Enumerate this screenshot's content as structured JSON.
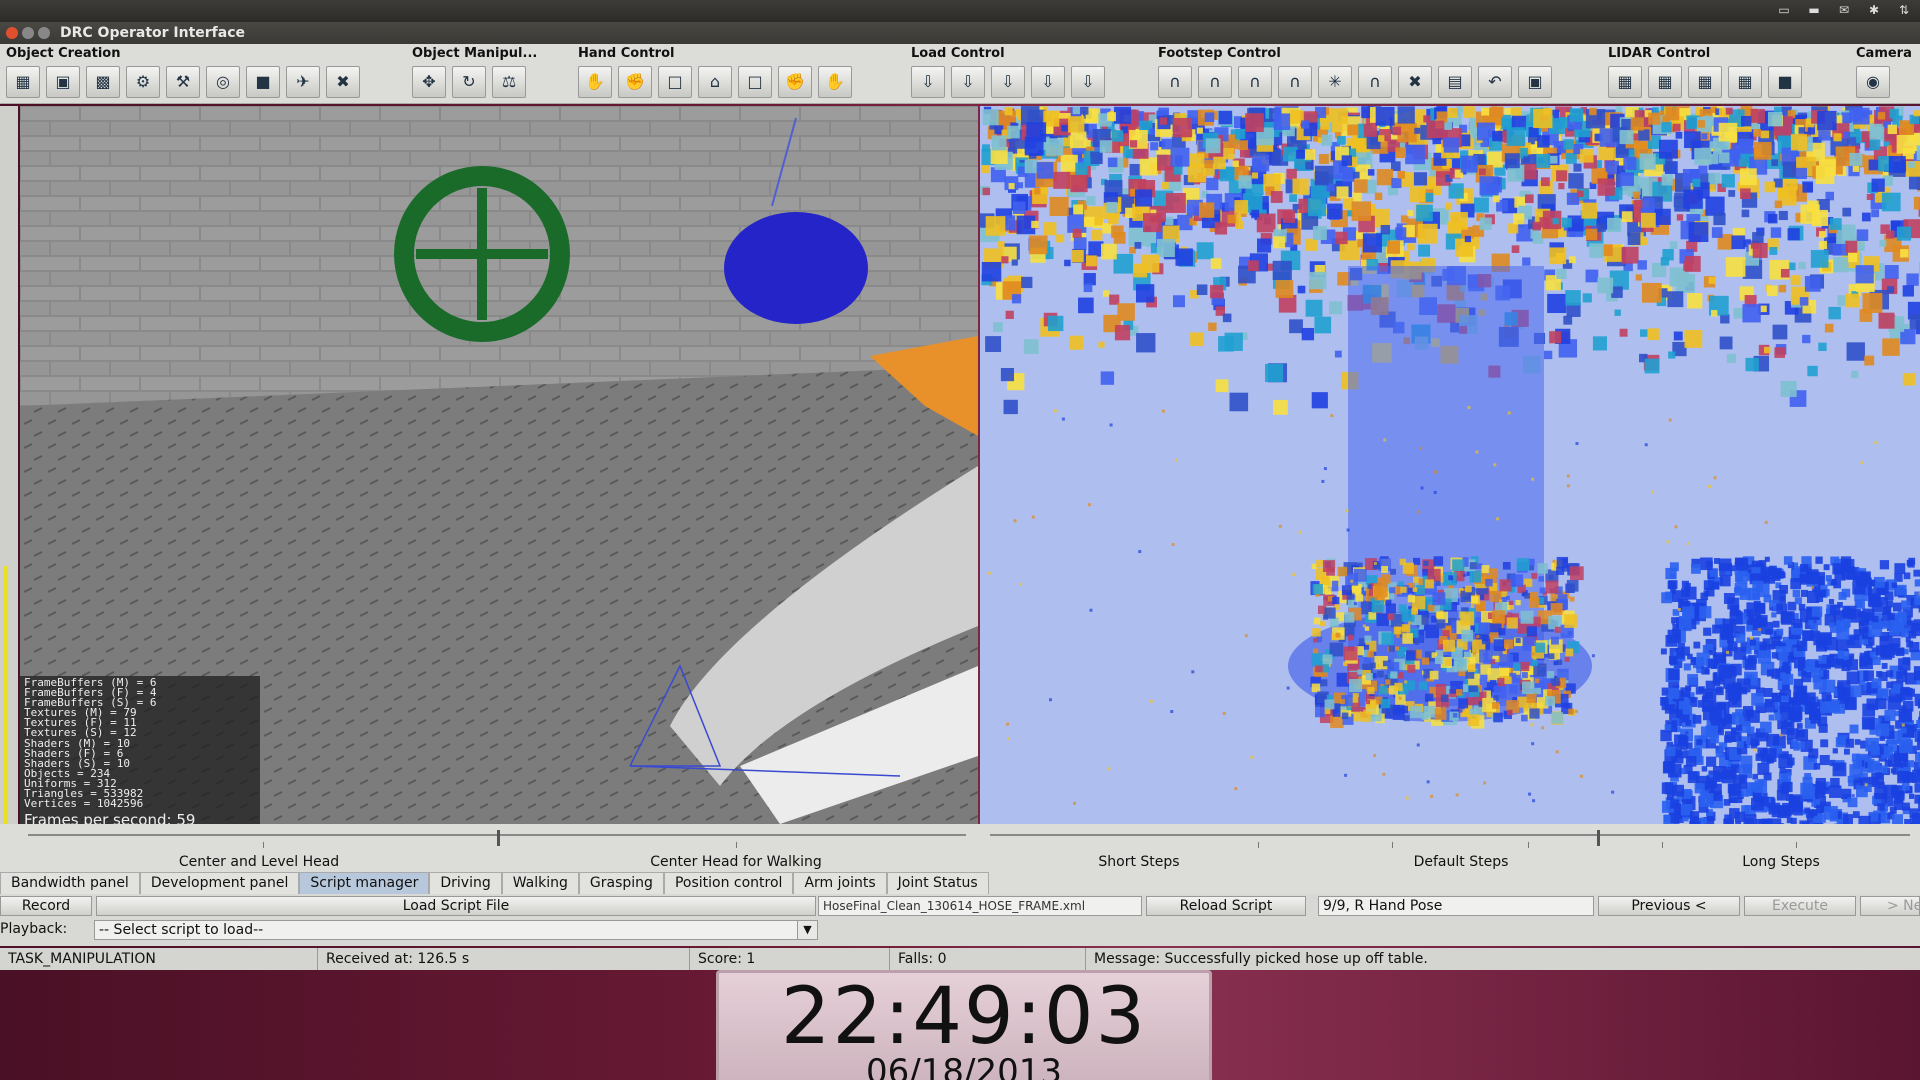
{
  "window": {
    "title": "DRC Operator Interface"
  },
  "toolbar": {
    "groups": [
      {
        "label": "Object Creation",
        "icons": [
          "▦",
          "▣",
          "▩",
          "⚙",
          "⚒",
          "◎",
          "■",
          "✈",
          "✖"
        ]
      },
      {
        "label": "Object Manipul...",
        "icons": [
          "✥",
          "↻",
          "⚖"
        ]
      },
      {
        "label": "Hand Control",
        "icons": [
          "✋",
          "✊",
          "□",
          "⌂",
          "□",
          "✊",
          "✋"
        ]
      },
      {
        "label": "Load Control",
        "icons": [
          "⇩",
          "⇩",
          "⇩",
          "⇩",
          "⇩"
        ]
      },
      {
        "label": "Footstep Control",
        "icons": [
          "∩",
          "∩",
          "∩",
          "∩",
          "✳",
          "∩",
          "✖",
          "▤",
          "↶",
          "▣"
        ]
      },
      {
        "label": "LIDAR Control",
        "icons": [
          "▦",
          "▦",
          "▦",
          "▦",
          "■"
        ]
      },
      {
        "label": "Camera",
        "icons": [
          "◉"
        ]
      }
    ]
  },
  "stats": {
    "lines": [
      "FrameBuffers (M) = 6",
      "FrameBuffers (F) = 4",
      "FrameBuffers (S) = 6",
      "Textures (M) = 79",
      "Textures (F) = 11",
      "Textures (S) = 12",
      "Shaders (M) = 10",
      "Shaders (F) = 6",
      "Shaders (S) = 10",
      "Objects = 234",
      "Uniforms = 312",
      "Triangles = 533982",
      "Vertices = 1042596"
    ],
    "fps": "Frames per second: 59"
  },
  "sliders": {
    "head_left": "Center and Level Head",
    "head_right": "Center Head for Walking",
    "head_position": 0.5,
    "steps": [
      "Short Steps",
      "Default Steps",
      "Long Steps"
    ],
    "steps_position": 0.66
  },
  "tabs": [
    "Bandwidth panel",
    "Development panel",
    "Script manager",
    "Driving",
    "Walking",
    "Grasping",
    "Position control",
    "Arm joints",
    "Joint Status"
  ],
  "active_tab": "Script manager",
  "script": {
    "record": "Record",
    "load": "Load Script File",
    "file": "HoseFinal_Clean_130614_HOSE_FRAME.xml",
    "reload": "Reload Script",
    "step": "9/9, R Hand Pose",
    "previous": "Previous <",
    "execute": "Execute",
    "next": "> Ne",
    "playback_label": "Playback:",
    "select": "-- Select script to load--"
  },
  "status": {
    "task": "TASK_MANIPULATION",
    "received": "Received at:  126.5 s",
    "score": "Score:  1",
    "falls": "Falls:  0",
    "message": "Message:  Successfully picked hose up off table."
  },
  "clock": {
    "time": "22:49:03",
    "date": "06/18/2013"
  },
  "colors": {
    "toolbar_bg": "#dcdcd8",
    "active_tab": "#b8c8dc",
    "desktop": "#6a1a35",
    "lidar_bg": "#aebfef"
  }
}
